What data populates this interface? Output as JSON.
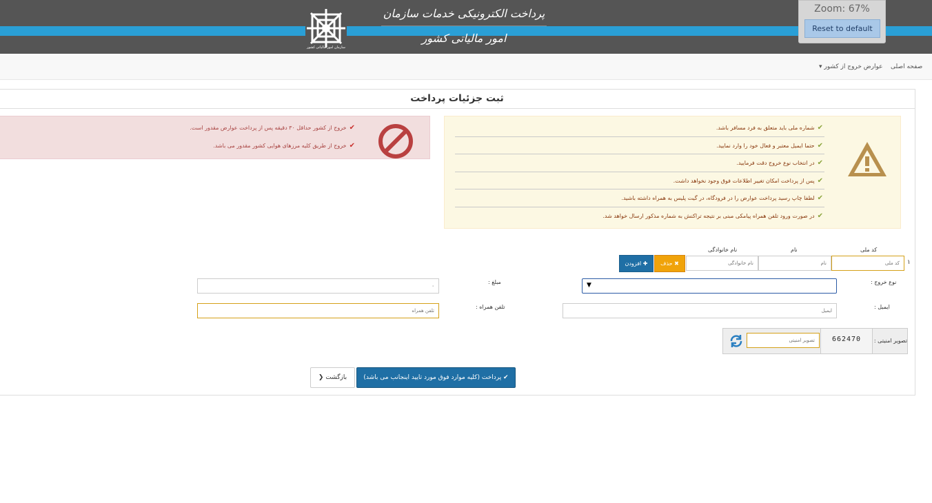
{
  "header": {
    "title": "پرداخت الکترونیکی خدمات سازمان امور مالیاتی کشور",
    "logo_caption": "سازمان امور مالیاتی کشور"
  },
  "zoom": {
    "label": "Zoom: 67%",
    "reset_label": "Reset to default"
  },
  "nav": {
    "home": "صفحه اصلی",
    "exit_fees": "عوارض خروج از کشور ▾"
  },
  "panel": {
    "title": "ثبت جزئیات پرداخت"
  },
  "warning_notes": [
    "شماره ملی باید متعلق به فرد مسافر باشد.",
    "حتما ایمیل معتبر و فعال خود را وارد نمایید.",
    "در انتخاب نوع خروج دقت فرمایید.",
    "پس از پرداخت امکان تغییر اطلاعات فوق وجود نخواهد داشت.",
    "لطفا چاپ رسید پرداخت عوارض را در فرودگاه، در گیت پلیس به همراه داشته باشید.",
    "در صورت ورود تلفن همراه پیامکی مبنی بر نتیجه تراکنش به شماره مذکور ارسال خواهد شد."
  ],
  "danger_notes": [
    "خروج از کشور حداقل ۳۰ دقیقه پس از پرداخت عوارض مقدور است.",
    "خروج از طریق کلیه مرزهای هوایی کشور مقدور می باشد."
  ],
  "passenger": {
    "row_number": "۱",
    "national_code_header": "کد ملی",
    "first_name_header": "نام",
    "last_name_header": "نام خانوادگی",
    "national_code_placeholder": "کد ملی",
    "first_name_placeholder": "نام",
    "last_name_placeholder": "نام خانوادگی",
    "delete_label": "✖ حذف",
    "add_label": "✚ افزودن"
  },
  "form": {
    "exit_type_label": "نوع خروج :",
    "amount_label": "مبلغ :",
    "amount_value": "۰",
    "email_label": "ایمیل :",
    "email_placeholder": "ایمیل",
    "mobile_label": "تلفن همراه :",
    "mobile_placeholder": "تلفن همراه",
    "captcha_label": "تصویر امنیتی :",
    "captcha_code": "662470",
    "captcha_placeholder": "تصویر امنیتی"
  },
  "actions": {
    "submit_label": "✔ پرداخت (کلیه موارد فوق مورد تایید اینجانب می باشد)",
    "back_label": "بازگشت ❮"
  },
  "colors": {
    "header_bg": "#555555",
    "header_band": "#2a9fd6",
    "primary": "#1f6fa5",
    "warning_btn": "#f0a30a",
    "warning_bg": "#fcf8e3",
    "danger_bg": "#f2dede"
  }
}
